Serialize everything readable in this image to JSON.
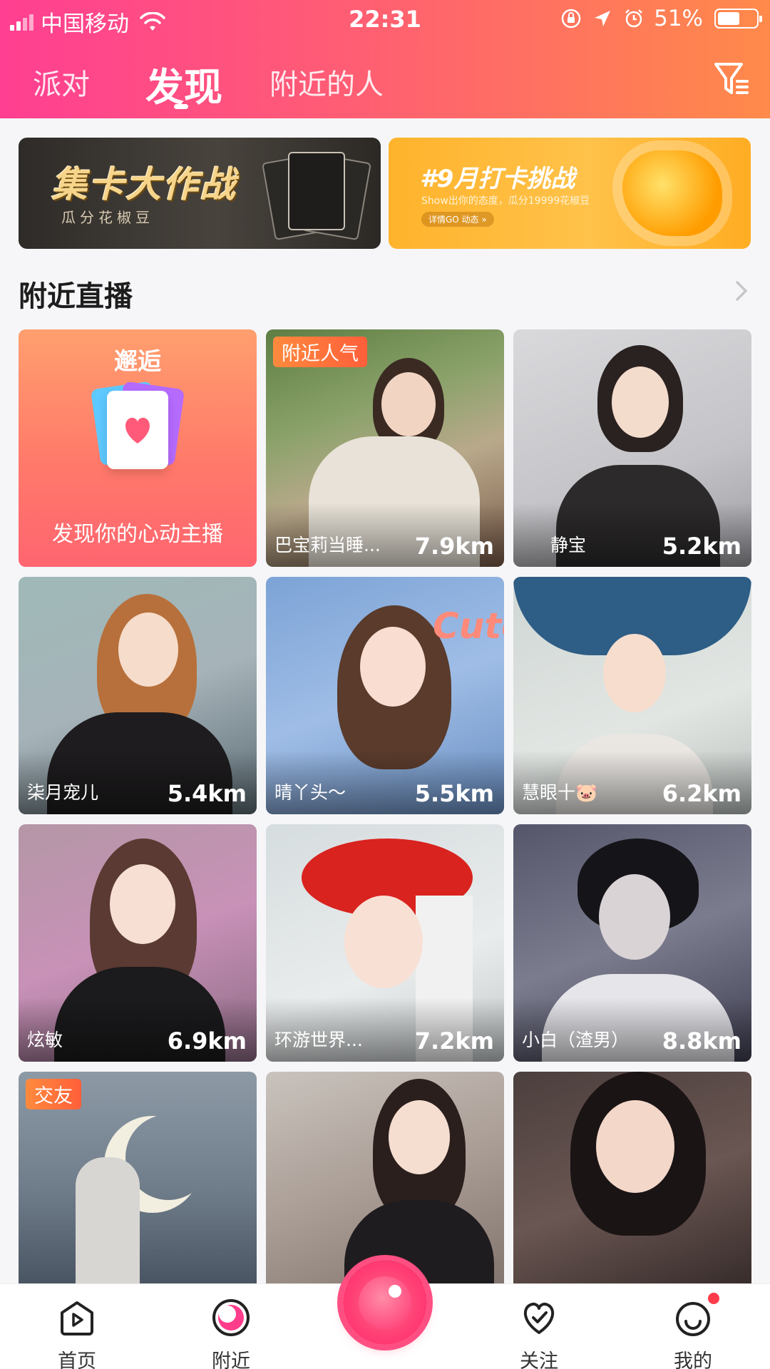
{
  "status_bar": {
    "carrier": "中国移动",
    "time": "22:31",
    "battery_percent": "51%",
    "battery_level": 0.51
  },
  "top_tabs": [
    {
      "label": "派对",
      "active": false
    },
    {
      "label": "发现",
      "active": true
    },
    {
      "label": "附近的人",
      "active": false
    }
  ],
  "banners": {
    "left": {
      "title": "集卡大作战",
      "subtitle": "瓜分花椒豆"
    },
    "right": {
      "title": "#9月打卡挑战",
      "subtitle": "Show出你的态度，瓜分19999花椒豆",
      "pill": "详情GO 动态 »"
    }
  },
  "section": {
    "title": "附近直播"
  },
  "promo": {
    "title": "邂逅",
    "subtitle": "发现你的心动主播"
  },
  "tiles": [
    {
      "name": "巴宝莉当睡...",
      "distance": "7.9km",
      "tag": "附近人气"
    },
    {
      "name": "静宝",
      "distance": "5.2km",
      "tag": ""
    },
    {
      "name": "柒月宠儿",
      "distance": "5.4km",
      "tag": ""
    },
    {
      "name": "晴丫头～",
      "distance": "5.5km",
      "tag": ""
    },
    {
      "name": "慧眼十🐷",
      "distance": "6.2km",
      "tag": ""
    },
    {
      "name": "炫敏",
      "distance": "6.9km",
      "tag": ""
    },
    {
      "name": "环游世界...",
      "distance": "7.2km",
      "tag": ""
    },
    {
      "name": "小白（渣男）",
      "distance": "8.8km",
      "tag": ""
    },
    {
      "name": "",
      "distance": "",
      "tag": "交友"
    },
    {
      "name": "",
      "distance": "",
      "tag": ""
    },
    {
      "name": "",
      "distance": "",
      "tag": ""
    }
  ],
  "bottom_nav": [
    {
      "label": "首页",
      "icon": "home-play-icon"
    },
    {
      "label": "附近",
      "icon": "nearby-icon"
    },
    {
      "label": "关注",
      "icon": "follow-heart-icon"
    },
    {
      "label": "我的",
      "icon": "profile-icon"
    }
  ],
  "colors": {
    "header_start": "#ff3f92",
    "header_end": "#ff8a4a",
    "accent": "#ff4f82",
    "tag": "#ff7a3c"
  }
}
